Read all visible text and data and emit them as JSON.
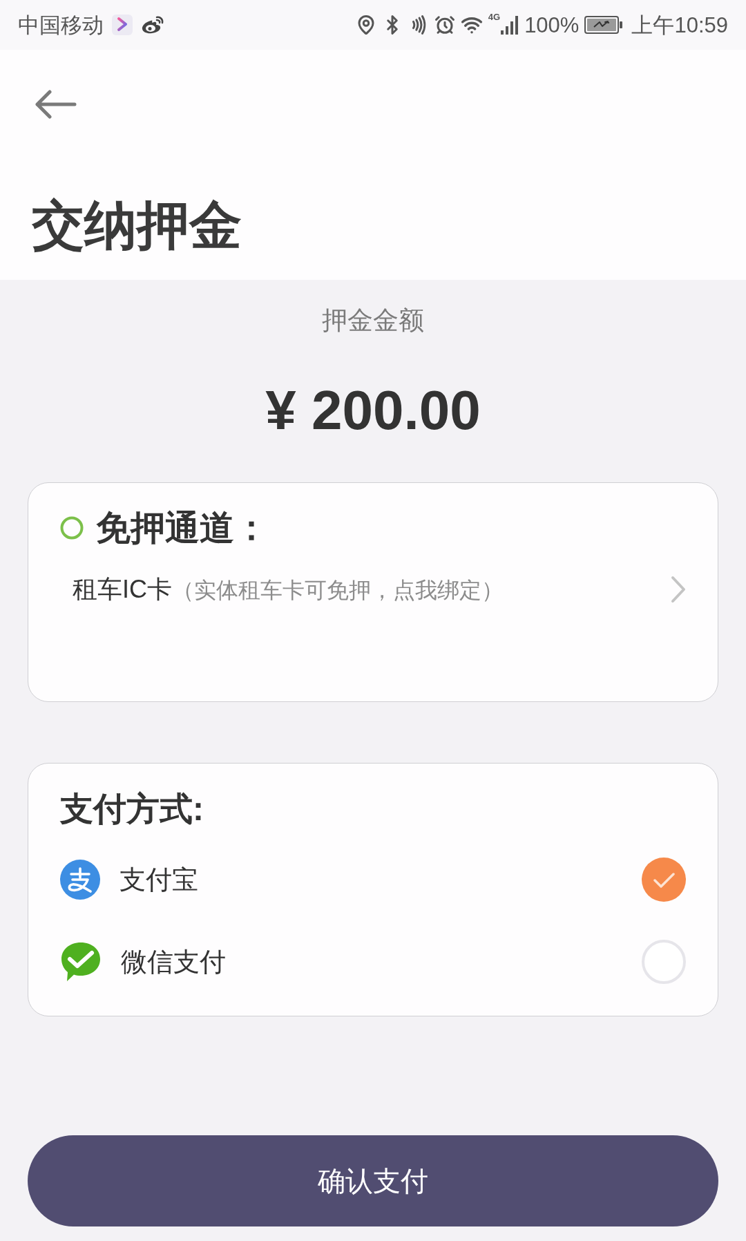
{
  "status_bar": {
    "carrier": "中国移动",
    "network": "4G",
    "battery": "100%",
    "time": "上午10:59"
  },
  "header": {
    "title": "交纳押金"
  },
  "deposit": {
    "label": "押金金额",
    "amount": "¥ 200.00"
  },
  "deposit_free": {
    "title": "免押通道：",
    "option": {
      "name": "租车IC卡",
      "hint": "（实体租车卡可免押，点我绑定）"
    }
  },
  "payment": {
    "title": "支付方式:",
    "methods": [
      {
        "kind": "alipay",
        "name": "支付宝",
        "selected": true
      },
      {
        "kind": "wechat",
        "name": "微信支付",
        "selected": false
      }
    ]
  },
  "confirm_button": {
    "label": "确认支付"
  }
}
